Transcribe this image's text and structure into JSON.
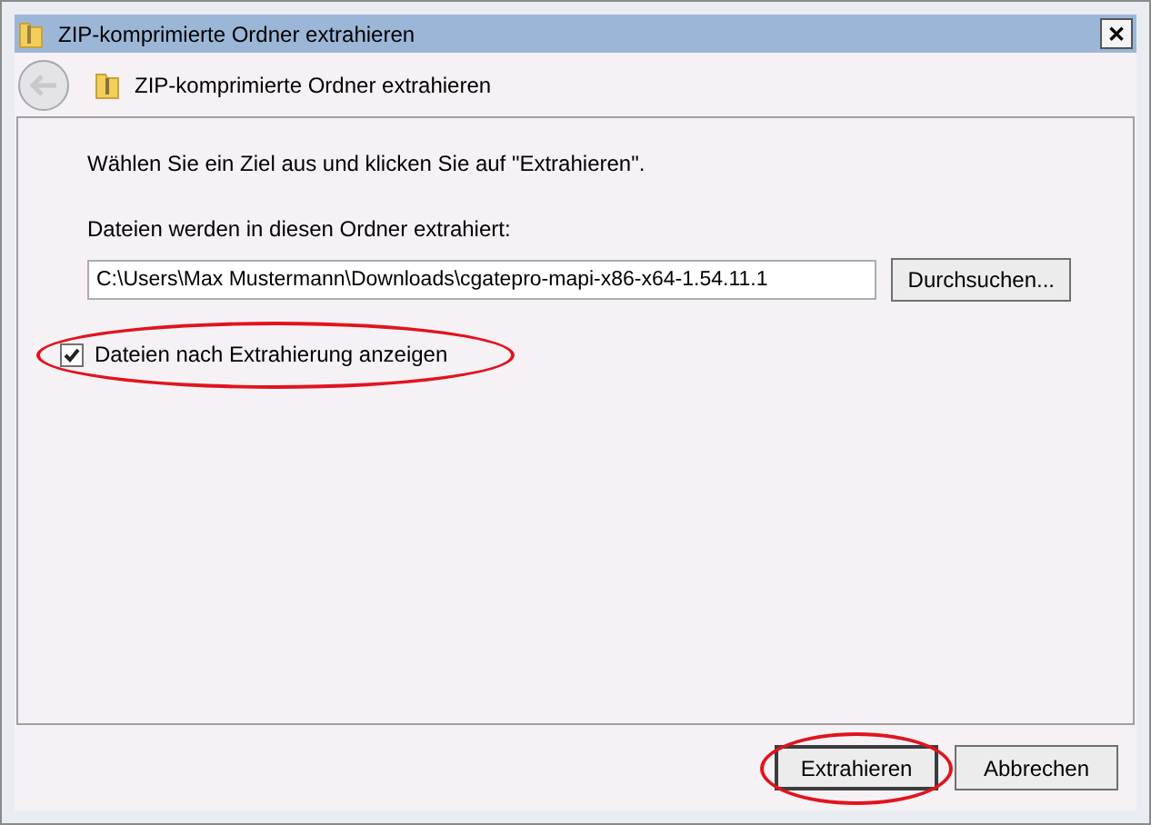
{
  "window": {
    "title": "ZIP-komprimierte Ordner extrahieren",
    "close": "✕"
  },
  "header": {
    "title": "ZIP-komprimierte Ordner extrahieren"
  },
  "instruction": "Wählen Sie ein Ziel aus und klicken Sie auf \"Extrahieren\".",
  "path_label": "Dateien werden in diesen Ordner extrahiert:",
  "path_field": {
    "value": "C:\\Users\\Max Mustermann\\Downloads\\cgatepro-mapi-x86-x64-1.54.11.1"
  },
  "browse_button": "Durchsuchen...",
  "show_files": {
    "label": "Dateien nach Extrahierung anzeigen",
    "checked": true,
    "highlighted": true
  },
  "buttons": [
    {
      "label": "Extrahieren",
      "default": true,
      "highlighted": true
    },
    {
      "label": "Abbrechen",
      "default": false,
      "highlighted": false
    }
  ]
}
